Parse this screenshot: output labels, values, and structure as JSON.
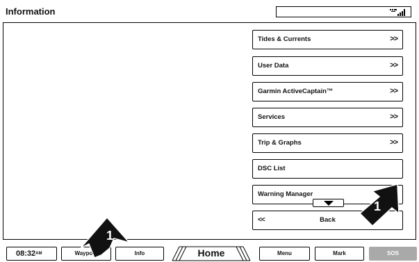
{
  "header": {
    "title": "Information",
    "signal_icon": "signal-strength-icon"
  },
  "menu": {
    "items": [
      {
        "label": "Tides & Currents",
        "arrow": ">>"
      },
      {
        "label": "User Data",
        "arrow": ">>"
      },
      {
        "label": "Garmin ActiveCaptain™",
        "arrow": ">>"
      },
      {
        "label": "Services",
        "arrow": ">>"
      },
      {
        "label": "Trip & Graphs",
        "arrow": ">>"
      },
      {
        "label": "DSC List",
        "arrow": ""
      },
      {
        "label": "Warning Manager",
        "arrow": ""
      }
    ],
    "back": {
      "arrow": "<<",
      "label": "Back"
    },
    "scroll_icon": "scroll-down-icon"
  },
  "bottom_bar": {
    "clock": {
      "time": "08:32",
      "ampm": "AM"
    },
    "waypoints": "Waypoin",
    "info": "Info",
    "home": "Home",
    "menu": "Menu",
    "mark": "Mark",
    "sos": "SOS"
  },
  "callouts": {
    "left": "1",
    "right": "1"
  },
  "colors": {
    "sos_bg": "#a9a9a9",
    "callout": "#111111"
  }
}
